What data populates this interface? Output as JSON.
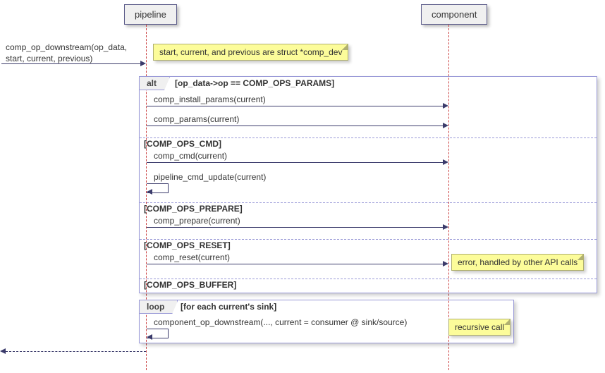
{
  "participants": {
    "pipeline": "pipeline",
    "component": "component"
  },
  "initial_call": {
    "line1": "comp_op_downstream(op_data,",
    "line2": "start, current, previous)"
  },
  "notes": {
    "initial": "start, current, and previous are struct *comp_dev",
    "reset": "error, handled by other API calls",
    "loop": "recursive call"
  },
  "alt": {
    "label": "alt",
    "cond_params": "[op_data->op == COMP_OPS_PARAMS]",
    "cond_cmd": "[COMP_OPS_CMD]",
    "cond_prepare": "[COMP_OPS_PREPARE]",
    "cond_reset": "[COMP_OPS_RESET]",
    "cond_buffer": "[COMP_OPS_BUFFER]"
  },
  "messages": {
    "install_params": "comp_install_params(current)",
    "params": "comp_params(current)",
    "cmd": "comp_cmd(current)",
    "cmd_update": "pipeline_cmd_update(current)",
    "prepare": "comp_prepare(current)",
    "reset": "comp_reset(current)"
  },
  "loop": {
    "label": "loop",
    "cond": "[for each current's sink]",
    "msg": "component_op_downstream(..., current = consumer @ sink/source)"
  },
  "chart_data": {
    "type": "sequence_diagram",
    "participants": [
      "pipeline",
      "component"
    ],
    "messages": [
      {
        "from": "caller",
        "to": "pipeline",
        "text": "comp_op_downstream(op_data, start, current, previous)",
        "note": "start, current, and previous are struct *comp_dev"
      },
      {
        "fragment": "alt",
        "guards": [
          {
            "guard": "op_data->op == COMP_OPS_PARAMS",
            "msgs": [
              {
                "from": "pipeline",
                "to": "component",
                "text": "comp_install_params(current)"
              },
              {
                "from": "pipeline",
                "to": "component",
                "text": "comp_params(current)"
              }
            ]
          },
          {
            "guard": "COMP_OPS_CMD",
            "msgs": [
              {
                "from": "pipeline",
                "to": "component",
                "text": "comp_cmd(current)"
              },
              {
                "from": "pipeline",
                "to": "pipeline",
                "text": "pipeline_cmd_update(current)"
              }
            ]
          },
          {
            "guard": "COMP_OPS_PREPARE",
            "msgs": [
              {
                "from": "pipeline",
                "to": "component",
                "text": "comp_prepare(current)"
              }
            ]
          },
          {
            "guard": "COMP_OPS_RESET",
            "msgs": [
              {
                "from": "pipeline",
                "to": "component",
                "text": "comp_reset(current)",
                "note": "error, handled by other API calls"
              }
            ]
          },
          {
            "guard": "COMP_OPS_BUFFER",
            "msgs": []
          }
        ]
      },
      {
        "fragment": "loop",
        "guard": "for each current's sink",
        "msgs": [
          {
            "from": "pipeline",
            "to": "pipeline",
            "text": "component_op_downstream(..., current = consumer @ sink/source)",
            "note": "recursive call"
          }
        ]
      },
      {
        "from": "pipeline",
        "to": "caller",
        "text": "",
        "style": "dashed"
      }
    ]
  }
}
